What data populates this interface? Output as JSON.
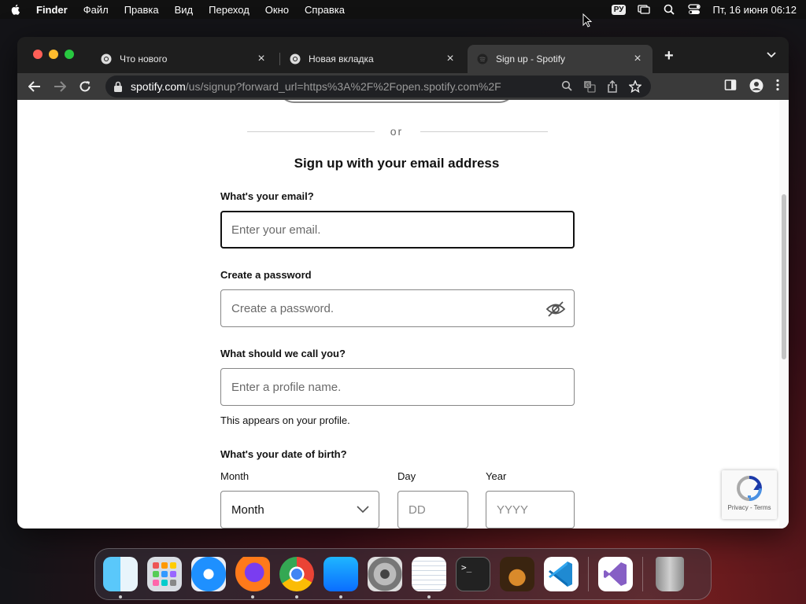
{
  "menubar": {
    "app_name": "Finder",
    "items": [
      "Файл",
      "Правка",
      "Вид",
      "Переход",
      "Окно",
      "Справка"
    ],
    "lang": "РУ",
    "clock": "Пт, 16 июня  06:12"
  },
  "tabs": [
    {
      "title": "Что нового",
      "icon": "chrome-icon"
    },
    {
      "title": "Новая вкладка",
      "icon": "chrome-icon"
    },
    {
      "title": "Sign up - Spotify",
      "icon": "spotify-icon"
    }
  ],
  "omnibox": {
    "domain": "spotify.com",
    "path": "/us/signup?forward_url=https%3A%2F%2Fopen.spotify.com%2F"
  },
  "page": {
    "or_text": "or",
    "heading": "Sign up with your email address",
    "email": {
      "label": "What's your email?",
      "placeholder": "Enter your email."
    },
    "password": {
      "label": "Create a password",
      "placeholder": "Create a password."
    },
    "profile": {
      "label": "What should we call you?",
      "placeholder": "Enter a profile name.",
      "hint": "This appears on your profile."
    },
    "dob": {
      "label": "What's your date of birth?",
      "month_label": "Month",
      "month_value": "Month",
      "day_label": "Day",
      "day_placeholder": "DD",
      "year_label": "Year",
      "year_placeholder": "YYYY"
    },
    "recaptcha": {
      "links": "Privacy - Terms"
    }
  },
  "dock": [
    "finder",
    "launchpad",
    "safari",
    "firefox",
    "chrome",
    "app-store",
    "system-settings",
    "textedit",
    "terminal",
    "garageband",
    "vscode",
    "visual-studio",
    "trash"
  ]
}
